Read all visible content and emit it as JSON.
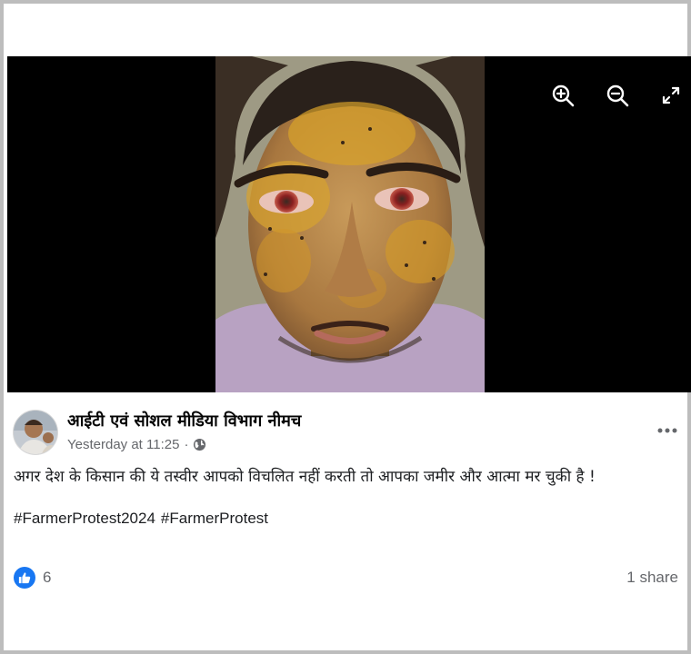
{
  "post": {
    "author": "आईटी एवं सोशल मीडिया विभाग नीमच",
    "timestamp": "Yesterday at 11:25",
    "separator": "·",
    "audience_icon": "globe-icon",
    "more_icon": "more-horizontal-icon",
    "text": "अगर देश के किसान की ये तस्वीर आपको विचलित नहीं करती तो आपका जमीर और आत्मा मर चुकी है !",
    "hashtags": [
      "#FarmerProtest2024",
      "#FarmerProtest"
    ]
  },
  "media_toolbar": {
    "zoom_in_icon": "zoom-in-icon",
    "zoom_out_icon": "zoom-out-icon",
    "fullscreen_icon": "fullscreen-icon"
  },
  "engagement": {
    "reaction_icon": "like-reaction-icon",
    "reaction_count": "6",
    "shares": "1 share"
  },
  "colors": {
    "like_blue": "#1877f2",
    "meta_gray": "#65676b",
    "media_background": "#000000"
  }
}
